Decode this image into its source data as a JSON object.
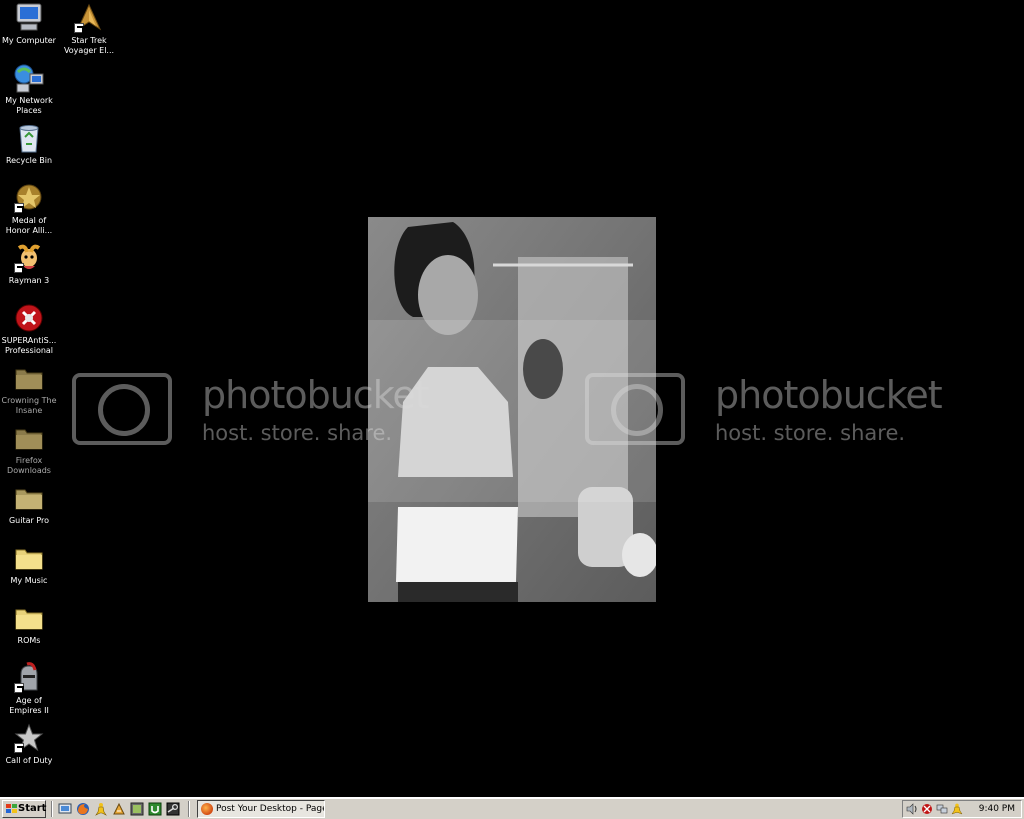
{
  "desktop": {
    "icons": [
      {
        "id": "my-computer",
        "label": "My Computer",
        "icon": "computer-icon"
      },
      {
        "id": "star-trek",
        "label": "Star Trek Voyager El...",
        "icon": "star-trek-badge-icon"
      },
      {
        "id": "my-network-places",
        "label": "My Network Places",
        "icon": "network-icon"
      },
      {
        "id": "recycle-bin",
        "label": "Recycle Bin",
        "icon": "recycle-bin-icon"
      },
      {
        "id": "medal-of-honor",
        "label": "Medal of Honor Alli...",
        "icon": "medal-icon"
      },
      {
        "id": "rayman-3",
        "label": "Rayman 3",
        "icon": "rayman-icon"
      },
      {
        "id": "superantispyware",
        "label": "SUPERAntiS... Professional",
        "icon": "superantispyware-icon"
      },
      {
        "id": "crowning-the-insane",
        "label": "Crowning The Insane",
        "icon": "folder-icon"
      },
      {
        "id": "firefox-downloads",
        "label": "Firefox Downloads",
        "icon": "folder-icon"
      },
      {
        "id": "guitar-pro",
        "label": "Guitar Pro",
        "icon": "folder-icon"
      },
      {
        "id": "my-music",
        "label": "My Music",
        "icon": "music-folder-icon"
      },
      {
        "id": "roms",
        "label": "ROMs",
        "icon": "folder-icon"
      },
      {
        "id": "age-of-empires",
        "label": "Age of Empires II",
        "icon": "knight-helmet-icon"
      },
      {
        "id": "call-of-duty",
        "label": "Call of Duty",
        "icon": "star-icon"
      }
    ]
  },
  "watermark": {
    "brand": "photobucket",
    "tagline": "host. store. share."
  },
  "taskbar": {
    "start_label": "Start",
    "window_title": "Post Your Desktop - Page...",
    "clock": "9:40 PM",
    "quick_launch": [
      "show-desktop-icon",
      "firefox-icon",
      "aim-icon",
      "winamp-icon",
      "media-icon",
      "utorrent-icon",
      "steam-icon"
    ],
    "tray": [
      "volume-icon",
      "antivirus-icon",
      "network-status-icon",
      "aim-tray-icon"
    ]
  },
  "colors": {
    "desktop_bg": "#000000",
    "taskbar_bg": "#d4d0c8",
    "folder": "#d8c070"
  }
}
